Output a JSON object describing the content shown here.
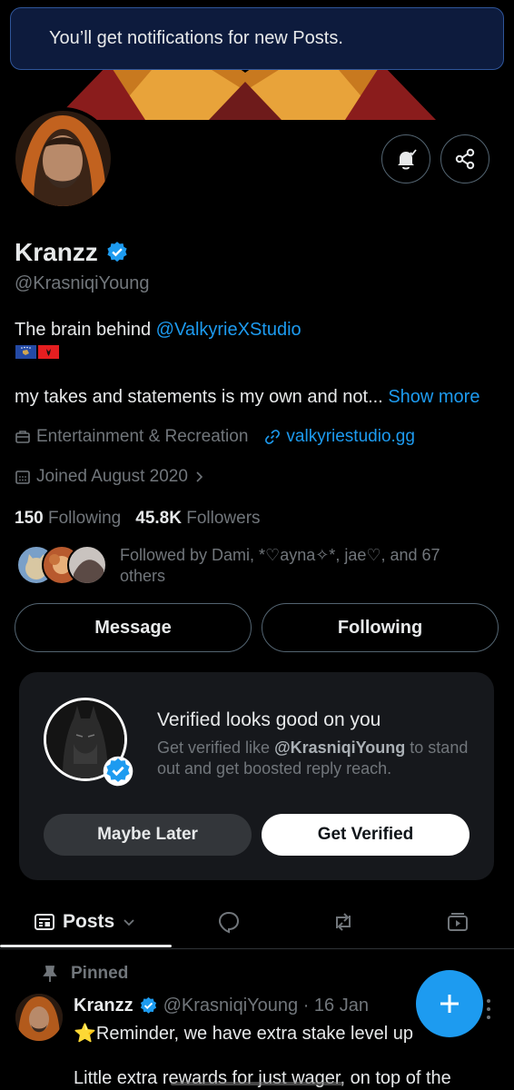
{
  "toast": {
    "text": "You’ll get notifications for new Posts."
  },
  "profile": {
    "name": "Kranzz",
    "handle": "@KrasniqiYoung",
    "bio_prefix": "The brain behind ",
    "bio_link": "@ValkyrieXStudio",
    "bio_more": "my takes and statements is my own and not...",
    "show_more": "Show more",
    "category": "Entertainment & Recreation",
    "website": "valkyriestudio.gg",
    "joined": "Joined August 2020",
    "following_count": "150",
    "following_label": "Following",
    "followers_count": "45.8K",
    "followers_label": "Followers",
    "followed_by": "Followed by Dami, *♡ayna✧*, jae♡, and 67 others"
  },
  "actions": {
    "message": "Message",
    "following": "Following"
  },
  "verify_card": {
    "title": "Verified looks good on you",
    "sub_prefix": "Get verified like ",
    "sub_handle": "@KrasniqiYoung",
    "sub_suffix": " to stand out and get boosted reply reach.",
    "later": "Maybe Later",
    "verify": "Get Verified"
  },
  "tabs": {
    "posts": "Posts"
  },
  "post": {
    "pinned": "Pinned",
    "name": "Kranzz",
    "handle_date": "@KrasniqiYoung · 16 Jan",
    "line1": "⭐Reminder, we have extra stake level up",
    "line2": "Little extra rewards for just wager, on top of the"
  },
  "colors": {
    "accent": "#1d9bf0",
    "toast_bg": "#0d1b3d",
    "card_bg": "#16181c"
  }
}
